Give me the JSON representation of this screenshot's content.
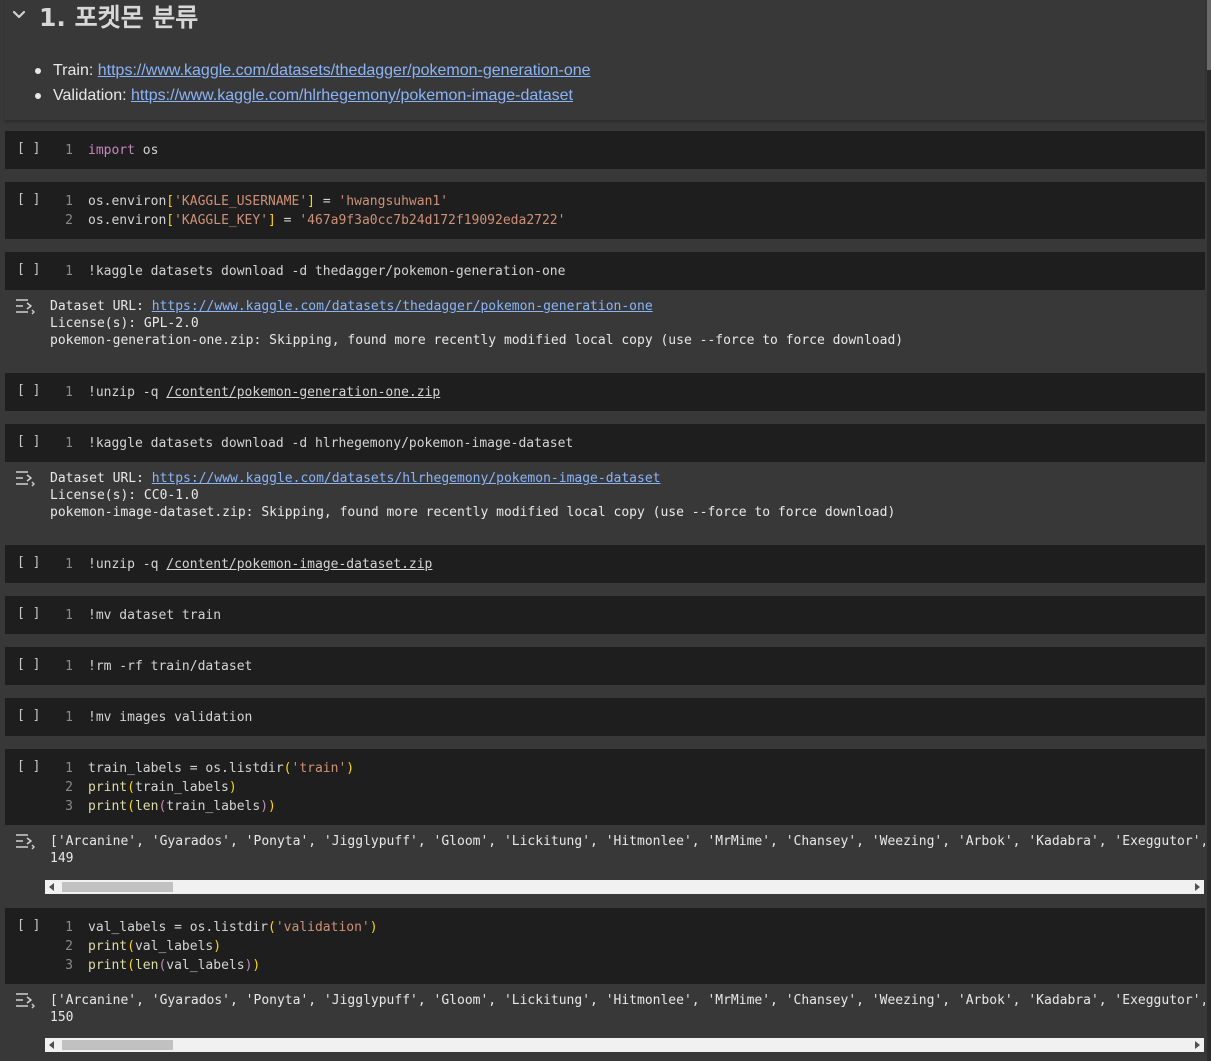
{
  "markdown": {
    "heading": "1. 포켓몬 분류",
    "items": [
      {
        "label": "Train:",
        "url": "https://www.kaggle.com/datasets/thedagger/pokemon-generation-one"
      },
      {
        "label": "Validation:",
        "url": "https://www.kaggle.com/hlrhegemony/pokemon-image-dataset"
      }
    ]
  },
  "cell_bracket": "[ ]",
  "cells": {
    "c1": {
      "l1": {
        "num": "1",
        "kw": "import",
        "rest": " os"
      }
    },
    "c2": {
      "l1": {
        "num": "1",
        "a": "os.environ",
        "b": "[",
        "c": "'KAGGLE_USERNAME'",
        "d": "]",
        "e": " = ",
        "f": "'hwangsuhwan1'"
      },
      "l2": {
        "num": "2",
        "a": "os.environ",
        "b": "[",
        "c": "'KAGGLE_KEY'",
        "d": "]",
        "e": " = ",
        "f": "'467a9f3a0cc7b24d172f19092eda2722'"
      }
    },
    "c3": {
      "l1": {
        "num": "1",
        "text": "!kaggle datasets download -d thedagger/pokemon-generation-one"
      }
    },
    "c4": {
      "l1": {
        "num": "1",
        "cmd": "!unzip -q ",
        "path": "/content/pokemon-generation-one.zip"
      }
    },
    "c5": {
      "l1": {
        "num": "1",
        "text": "!kaggle datasets download -d hlrhegemony/pokemon-image-dataset"
      }
    },
    "c6": {
      "l1": {
        "num": "1",
        "cmd": "!unzip -q ",
        "path": "/content/pokemon-image-dataset.zip"
      }
    },
    "c7": {
      "l1": {
        "num": "1",
        "text": "!mv dataset train"
      }
    },
    "c8": {
      "l1": {
        "num": "1",
        "text": "!rm -rf train/dataset"
      }
    },
    "c9": {
      "l1": {
        "num": "1",
        "text": "!mv images validation"
      }
    },
    "c10": {
      "l1": {
        "num": "1",
        "a": "train_labels = os.listdir",
        "b": "(",
        "c": "'train'",
        "d": ")"
      },
      "l2": {
        "num": "2",
        "fn": "print",
        "b": "(",
        "a": "train_labels",
        "d": ")"
      },
      "l3": {
        "num": "3",
        "fn": "print",
        "b": "(",
        "fn2": "len",
        "b2": "(",
        "a": "train_labels",
        "d2": ")",
        "d": ")"
      }
    },
    "c11": {
      "l1": {
        "num": "1",
        "a": "val_labels = os.listdir",
        "b": "(",
        "c": "'validation'",
        "d": ")"
      },
      "l2": {
        "num": "2",
        "fn": "print",
        "b": "(",
        "a": "val_labels",
        "d": ")"
      },
      "l3": {
        "num": "3",
        "fn": "print",
        "b": "(",
        "fn2": "len",
        "b2": "(",
        "a": "val_labels",
        "d2": ")",
        "d": ")"
      }
    }
  },
  "outputs": {
    "o1": {
      "url_label": "Dataset URL: ",
      "url": "https://www.kaggle.com/datasets/thedagger/pokemon-generation-one",
      "license": "License(s): GPL-2.0",
      "msg": "pokemon-generation-one.zip: Skipping, found more recently modified local copy (use --force to force download)"
    },
    "o2": {
      "url_label": "Dataset URL: ",
      "url": "https://www.kaggle.com/datasets/hlrhegemony/pokemon-image-dataset",
      "license": "License(s): CC0-1.0",
      "msg": "pokemon-image-dataset.zip: Skipping, found more recently modified local copy (use --force to force download)"
    },
    "o3": {
      "list": "['Arcanine', 'Gyarados', 'Ponyta', 'Jigglypuff', 'Gloom', 'Lickitung', 'Hitmonlee', 'MrMime', 'Chansey', 'Weezing', 'Arbok', 'Kadabra', 'Exeggutor', 'Rhydon', 'Hypno",
      "count": "149"
    },
    "o4": {
      "list": "['Arcanine', 'Gyarados', 'Ponyta', 'Jigglypuff', 'Gloom', 'Lickitung', 'Hitmonlee', 'MrMime', 'Chansey', 'Weezing', 'Arbok', 'Kadabra', 'Exeggutor', 'Rhydon', 'Hypno",
      "count": "150"
    }
  },
  "icons": {
    "chevron": "chevron-down-icon",
    "output": "output-toggle-icon"
  },
  "colors": {
    "background": "#383838",
    "cell": "#1e1e1e",
    "keyword": "#c586c0",
    "string": "#ce9178",
    "function": "#dcdcaa",
    "bracket": "#ffd700",
    "link": "#8ab4f8"
  }
}
